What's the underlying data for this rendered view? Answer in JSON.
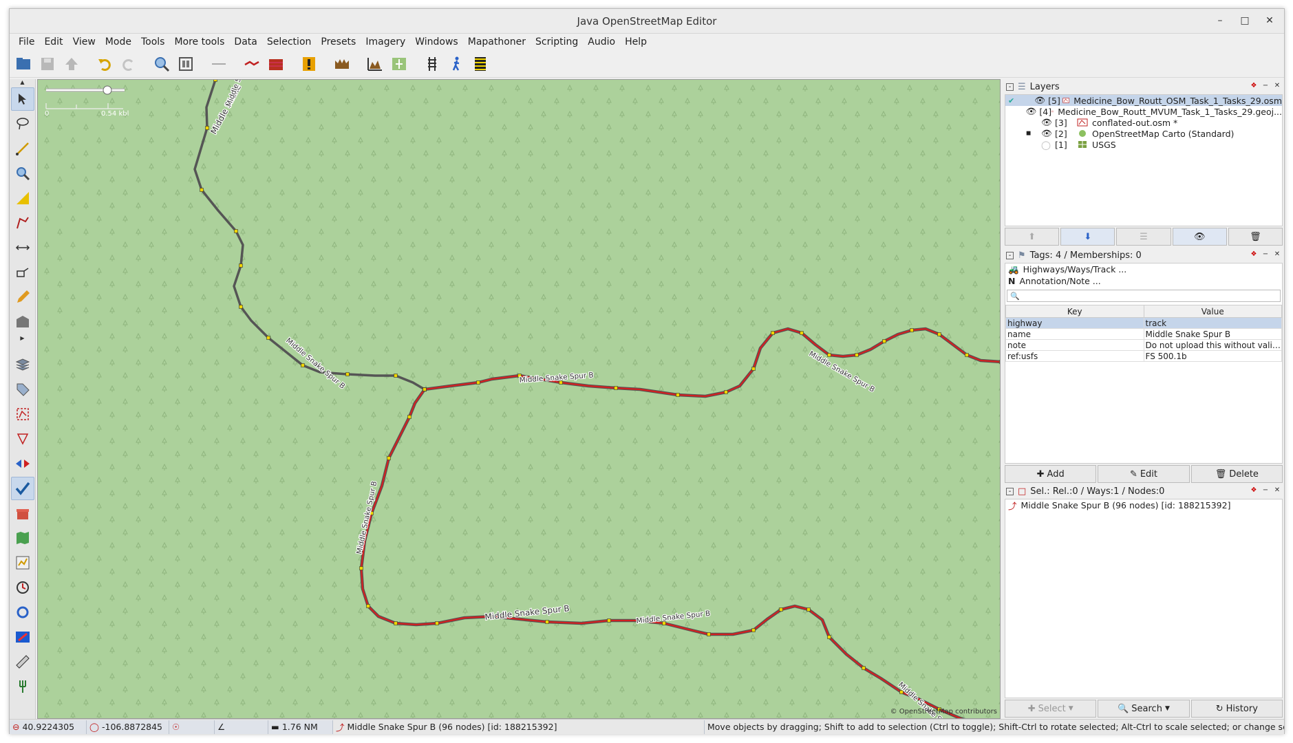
{
  "window": {
    "title": "Java OpenStreetMap Editor"
  },
  "menu": [
    "File",
    "Edit",
    "View",
    "Mode",
    "Tools",
    "More tools",
    "Data",
    "Selection",
    "Presets",
    "Imagery",
    "Windows",
    "Mapathoner",
    "Scripting",
    "Audio",
    "Help"
  ],
  "map": {
    "scale_start": "0",
    "scale_end": "0.54 kbl",
    "credit": "© OpenStreetMap contributors",
    "road_labels": [
      "Middle Snake",
      "Middle Snake Spur B",
      "Middle Snake Spur B",
      "Middle Snake Spur B",
      "Middle Snake Spur B",
      "Middle Snake Spur B",
      "Middle Snake Spur B",
      "Middle Snake Spur B",
      "Middle Snake Spur B"
    ],
    "colors": {
      "background": "#acd19b",
      "selected_way": "#d42020",
      "way": "#555555",
      "node": "#f0d400"
    }
  },
  "layers": {
    "title": "Layers",
    "items": [
      {
        "num": "[5]",
        "name": "Medicine_Bow_Routt_OSM_Task_1_Tasks_29.osm",
        "active": true,
        "visible": true
      },
      {
        "num": "[4]",
        "name": "Medicine_Bow_Routt_MVUM_Task_1_Tasks_29.geoj...",
        "active": false,
        "visible": true
      },
      {
        "num": "[3]",
        "name": "conflated-out.osm *",
        "active": false,
        "visible": true
      },
      {
        "num": "[2]",
        "name": "OpenStreetMap Carto (Standard)",
        "active": false,
        "visible": true
      },
      {
        "num": "[1]",
        "name": "USGS",
        "active": false,
        "visible": false
      }
    ]
  },
  "tags": {
    "title": "Tags: 4 / Memberships: 0",
    "presets": [
      "Highways/Ways/Track ...",
      "Annotation/Note ..."
    ],
    "key_header": "Key",
    "value_header": "Value",
    "rows": [
      {
        "key": "highway",
        "value": "track"
      },
      {
        "key": "name",
        "value": "Middle Snake Spur B"
      },
      {
        "key": "note",
        "value": "Do not upload this without validati..."
      },
      {
        "key": "ref:usfs",
        "value": "FS 500.1b"
      }
    ],
    "add_label": "Add",
    "edit_label": "Edit",
    "delete_label": "Delete"
  },
  "selection": {
    "title": "Sel.: Rel.:0 / Ways:1 / Nodes:0",
    "item": "Middle Snake Spur B (96 nodes) [id: 188215392]",
    "select_label": "Select",
    "search_label": "Search",
    "history_label": "History"
  },
  "status": {
    "lat": "40.9224305",
    "lon": "-106.8872845",
    "distance": "1.76 NM",
    "way": "Middle Snake Spur B (96 nodes) [id: 188215392]",
    "help": "Move objects by dragging; Shift to add to selection (Ctrl to toggle); Shift-Ctrl to rotate selected; Alt-Ctrl to scale selected; or change selection"
  }
}
